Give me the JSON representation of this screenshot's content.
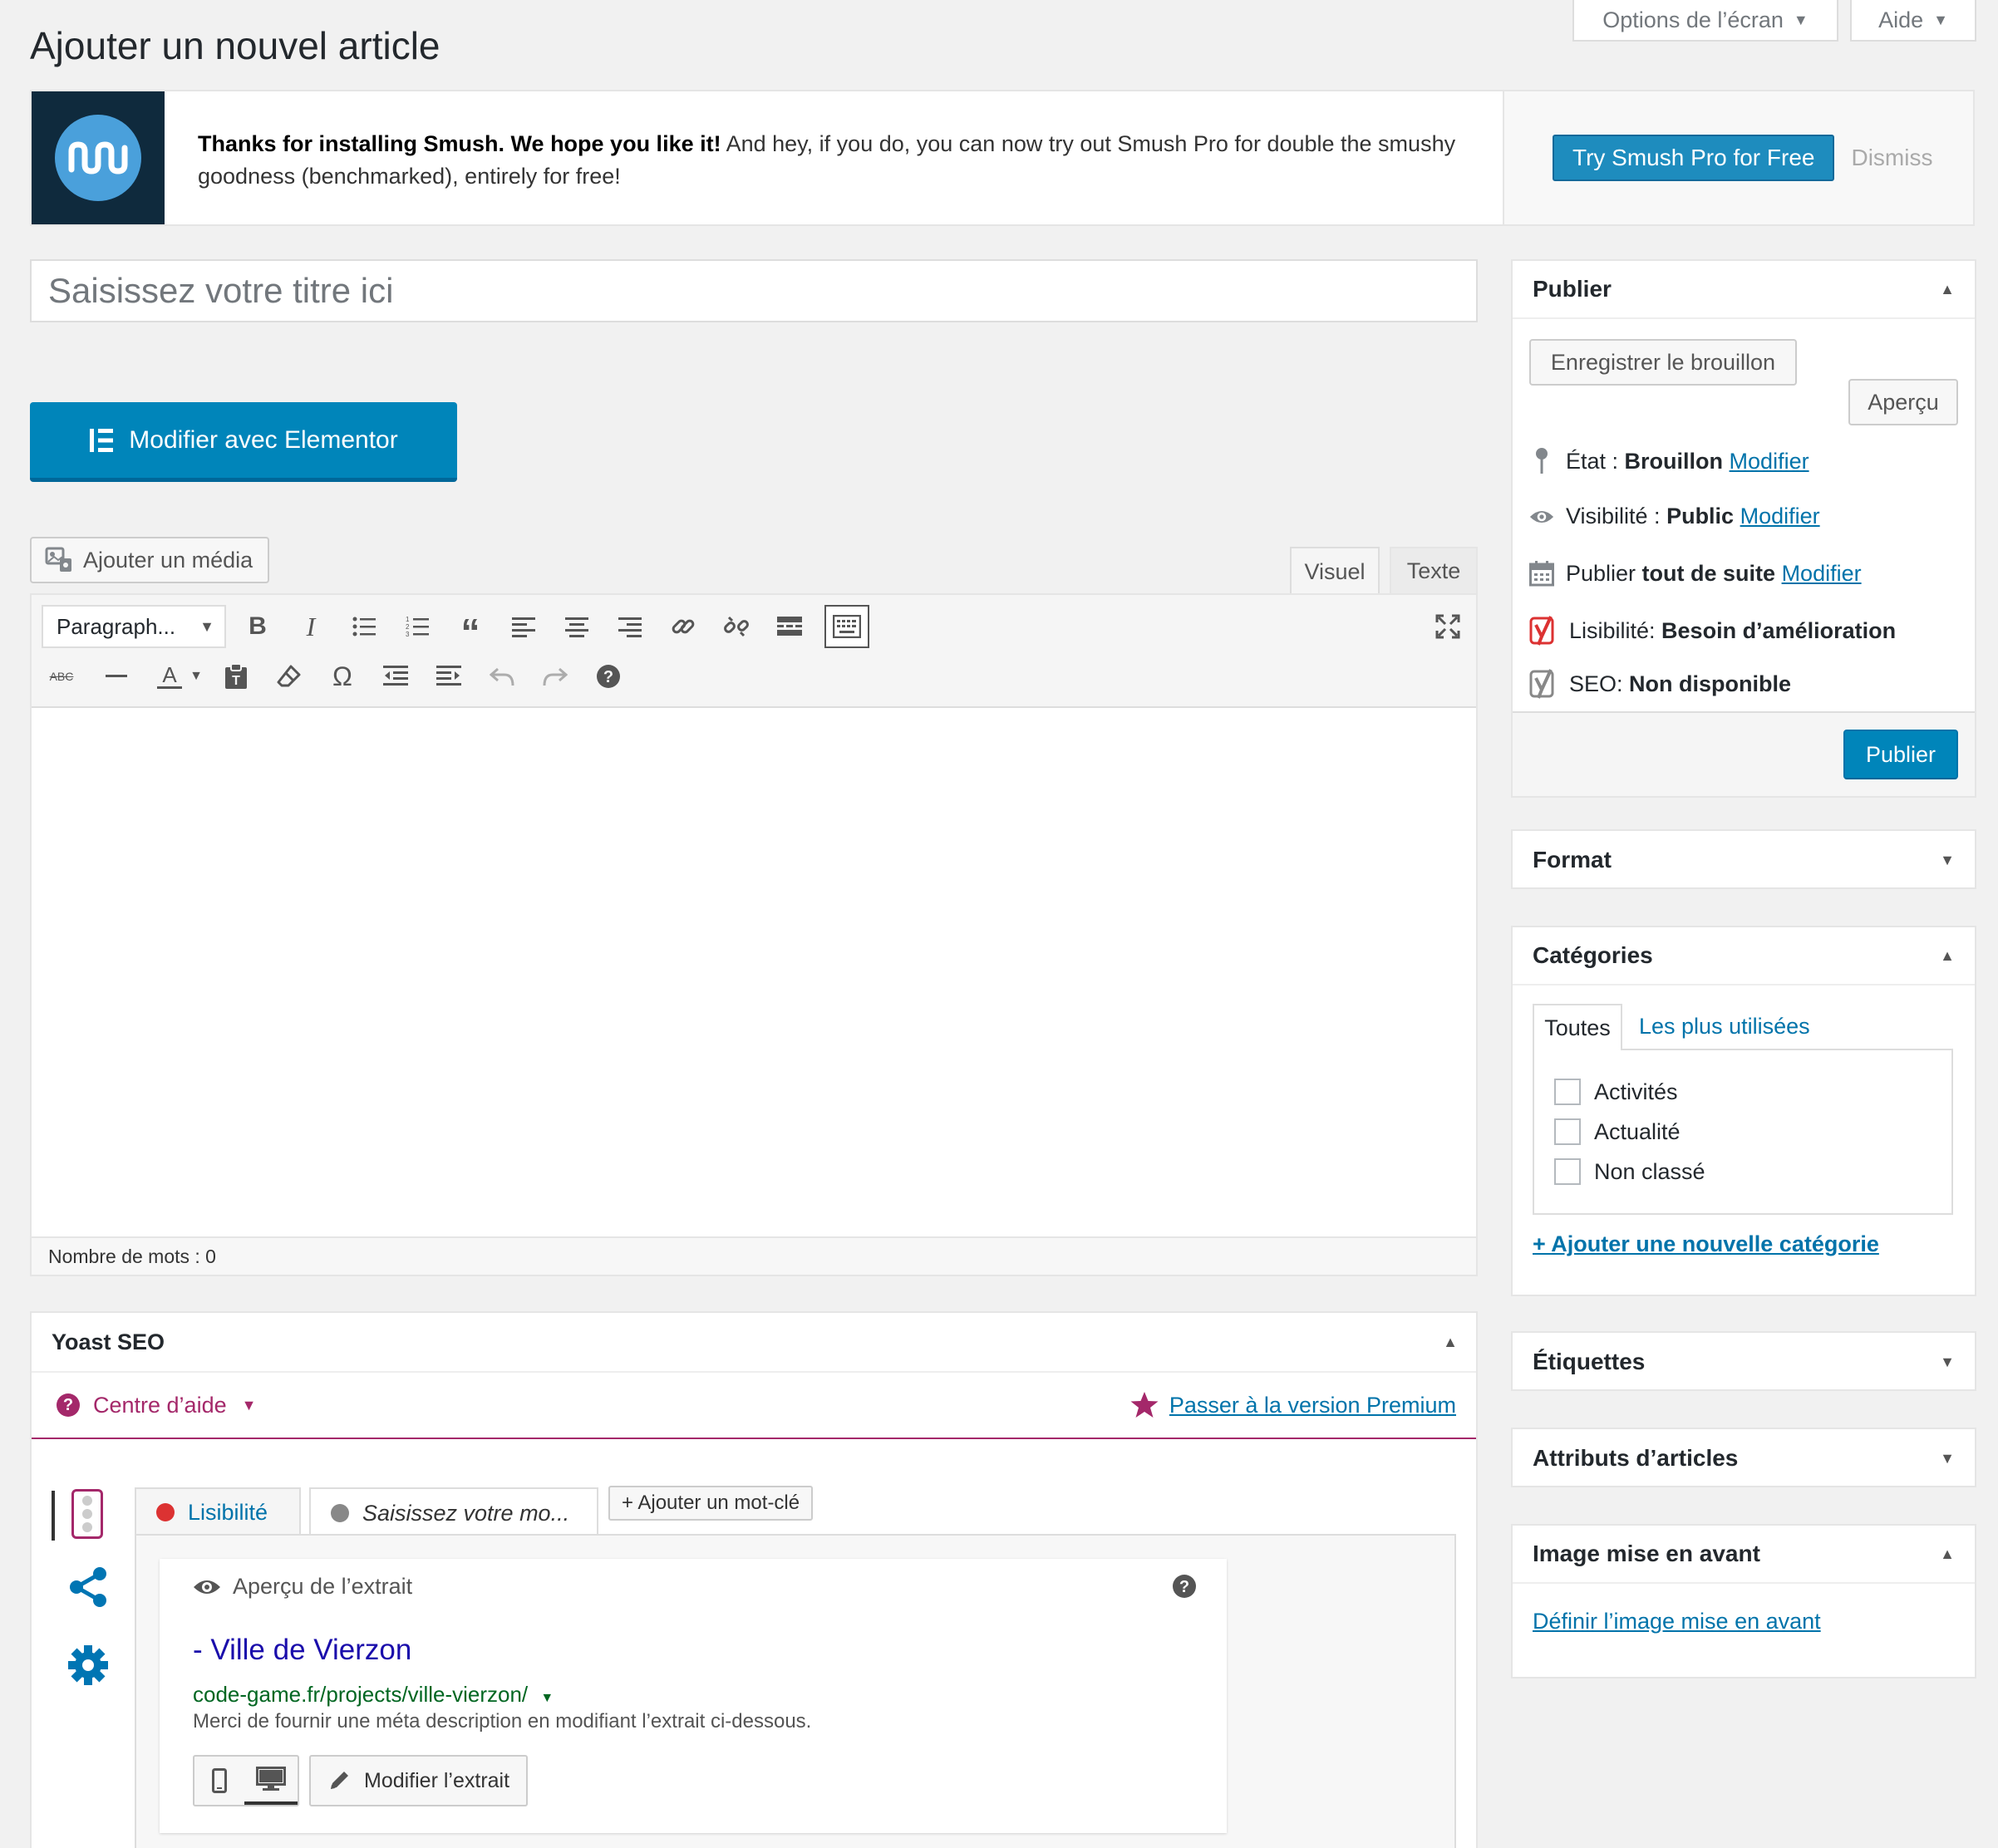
{
  "screen_options": {
    "label": "Options de l’écran",
    "help_label": "Aide"
  },
  "page_title": "Ajouter un nouvel article",
  "notice": {
    "bold_text": "Thanks for installing Smush. We hope you like it!",
    "text": " And hey, if you do, you can now try out Smush Pro for double the smushy goodness (benchmarked), entirely for free!",
    "cta_label": "Try Smush Pro for Free",
    "dismiss_label": "Dismiss"
  },
  "title_input": {
    "placeholder": "Saisissez votre titre ici"
  },
  "elementor_button": "Modifier avec Elementor",
  "add_media_button": "Ajouter un média",
  "editor": {
    "tab_visual": "Visuel",
    "tab_text": "Texte",
    "format_select": "Paragraph...",
    "word_count": "Nombre de mots : 0"
  },
  "yoast": {
    "title": "Yoast SEO",
    "help_center": "Centre d’aide",
    "premium_link": "Passer à la version Premium",
    "tab_readability": "Lisibilité",
    "tab_keyword": "Saisissez votre mo...",
    "add_keyword_button": "+ Ajouter un mot-clé",
    "snippet": {
      "heading": "Aperçu de l’extrait",
      "title": "- Ville de Vierzon",
      "url": "code-game.fr/projects/ville-vierzon/",
      "description": "Merci de fournir une méta description en modifiant l’extrait ci-dessous.",
      "edit_button": "Modifier l’extrait"
    }
  },
  "publish": {
    "title": "Publier",
    "save_draft": "Enregistrer le brouillon",
    "preview": "Aperçu",
    "status_label": "État : ",
    "status_value": "Brouillon",
    "visibility_label": "Visibilité : ",
    "visibility_value": "Public",
    "publish_label": "Publier ",
    "publish_value": "tout de suite",
    "modify": "Modifier",
    "readability_label": "Lisibilité: ",
    "readability_value": "Besoin d’amélioration",
    "seo_label": "SEO: ",
    "seo_value": "Non disponible",
    "publish_button": "Publier"
  },
  "format_box": {
    "title": "Format"
  },
  "categories": {
    "title": "Catégories",
    "tab_all": "Toutes",
    "tab_most_used": "Les plus utilisées",
    "items": [
      "Activités",
      "Actualité",
      "Non classé"
    ],
    "add_link": "+ Ajouter une nouvelle catégorie"
  },
  "tags_box": {
    "title": "Étiquettes"
  },
  "attributes_box": {
    "title": "Attributs d’articles"
  },
  "featured_image": {
    "title": "Image mise en avant",
    "link": "Définir l’image mise en avant"
  },
  "colors": {
    "wp_blue": "#0085ba",
    "link": "#0073aa",
    "yoast_purple": "#a4286a",
    "red_dot": "#dc3232",
    "gray_dot": "#888888"
  }
}
